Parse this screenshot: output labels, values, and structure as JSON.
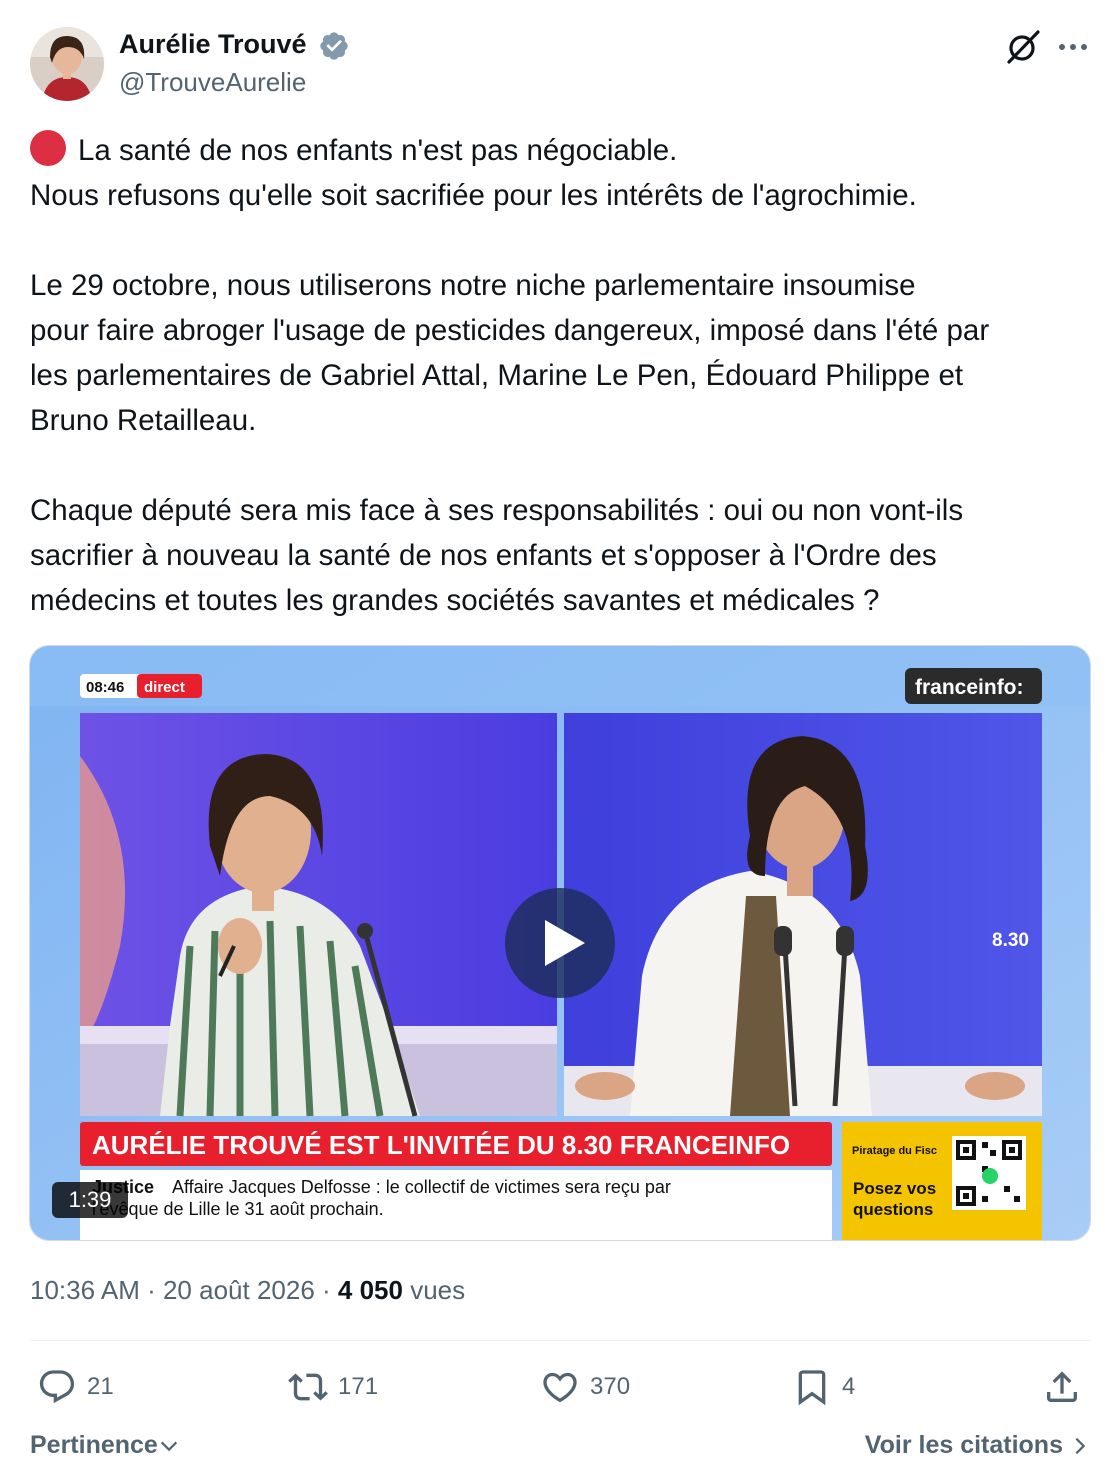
{
  "author": {
    "name": "Aurélie Trouvé",
    "handle": "@TrouveAurelie",
    "verified": true
  },
  "tweet": {
    "lines_block1": [
      "La santé de nos enfants n'est pas négociable.",
      "Nous refusons qu'elle soit sacrifiée pour les intérêts de l'agrochimie."
    ],
    "lines_block2": [
      "Le 29 octobre, nous utiliserons notre niche parlementaire insoumise",
      "pour faire abroger l'usage de pesticides dangereux, imposé dans l'été par",
      "les parlementaires de Gabriel Attal, Marine Le Pen, Édouard Philippe et",
      "Bruno Retailleau."
    ],
    "lines_block3": [
      "Chaque député sera mis face à ses responsabilités : oui ou non vont-ils",
      "sacrifier à nouveau la santé de nos enfants et s'opposer à l'Ordre des",
      "médecins et toutes les grandes sociétés savantes et médicales ?"
    ],
    "emoji": "red-circle"
  },
  "video": {
    "time": "08:46",
    "live": "direct",
    "channel": "franceinfo:",
    "side_label": "8.30",
    "banner": "AURÉLIE TROUVÉ EST L'INVITÉE DU 8.30 FRANCEINFO",
    "ticker_tag": "Justice",
    "ticker_line1": "Affaire Jacques Delfosse : le collectif de victimes sera reçu par",
    "ticker_line2": "l'évêque de Lille le 31 août prochain.",
    "promo_small": "Piratage du Fisc",
    "promo_text1": "Posez vos",
    "promo_text2": "questions",
    "duration": "1:39"
  },
  "meta": {
    "time": "10:36 AM",
    "sep1": " · ",
    "date": "20 août 2026",
    "sep2": " · ",
    "views_count": "4 050",
    "views_label": " vues"
  },
  "actions": {
    "replies": "21",
    "reposts": "171",
    "likes": "370",
    "bookmarks": "4"
  },
  "footer": {
    "sort_label": "Pertinence",
    "quotes_label": "Voir les citations"
  },
  "colors": {
    "text": "#0f1419",
    "secondary": "#536471",
    "verified": "#829aab",
    "banner_red": "#e8202e",
    "promo_yellow": "#f5c400"
  }
}
